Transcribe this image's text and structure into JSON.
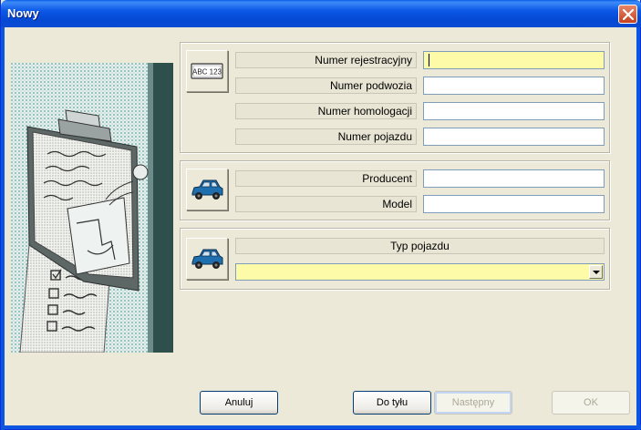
{
  "window": {
    "title": "Nowy"
  },
  "registration_group": {
    "icon": "license-plate-icon",
    "plate_text": "ABC 123",
    "fields": [
      {
        "label": "Numer rejestracyjny",
        "value": ""
      },
      {
        "label": "Numer podwozia",
        "value": ""
      },
      {
        "label": "Numer homologacji",
        "value": ""
      },
      {
        "label": "Numer pojazdu",
        "value": ""
      }
    ]
  },
  "vehicle_group": {
    "icon": "car-icon",
    "fields": [
      {
        "label": "Producent",
        "value": ""
      },
      {
        "label": "Model",
        "value": ""
      }
    ]
  },
  "type_group": {
    "icon": "car-icon",
    "label": "Typ pojazdu",
    "selected": ""
  },
  "buttons": {
    "cancel": "Anuluj",
    "back": "Do tyłu",
    "next": "Następny",
    "ok": "OK"
  },
  "colors": {
    "title_bar": "#0b58e6",
    "active_field": "#fdfaa8",
    "car_body": "#1f6fae"
  }
}
